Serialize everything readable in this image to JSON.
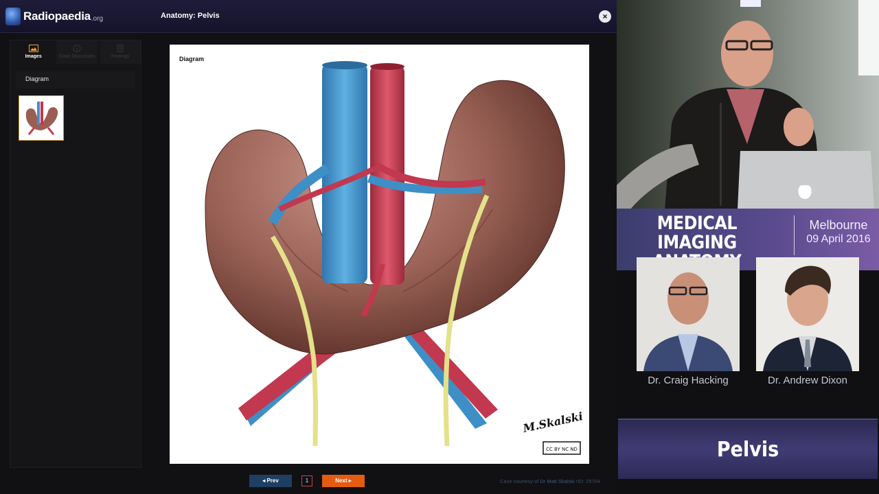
{
  "brand": {
    "name": "Radiopaedia",
    "tld": ".org"
  },
  "viewer": {
    "title": "Anatomy: Pelvis",
    "close_symbol": "×",
    "tabs": [
      {
        "label": "Images",
        "icon": "image-icon",
        "active": true
      },
      {
        "label": "Case Discussion",
        "icon": "info-icon",
        "active": false
      },
      {
        "label": "Findings",
        "icon": "document-icon",
        "active": false
      }
    ],
    "section_label": "Diagram",
    "image_label": "Diagram",
    "signature": "M.Skalski",
    "license_badge": "CC BY NC ND"
  },
  "pager": {
    "prev_label": "◂  Prev",
    "next_label": "Next  ▸",
    "current_page": "1"
  },
  "courtesy": {
    "prefix": "Case courtesy of ",
    "author": "Dr Matt Skalski",
    "suffix": " rID: 29704"
  },
  "presentation": {
    "title_line1": "MEDICAL IMAGING",
    "title_line2": "ANATOMY",
    "city": "Melbourne",
    "date": "09 April 2016",
    "speakers": [
      "Dr. Craig Hacking",
      "Dr. Andrew Dixon"
    ],
    "topic": "Pelvis"
  },
  "colors": {
    "accent_orange": "#e35c11",
    "nav_blue": "#1e3f63",
    "banner_purple": "#5a4b8e",
    "artery_red": "#c2384e",
    "vein_blue": "#3f8fc7",
    "ureter_yellow": "#e4e18a"
  }
}
